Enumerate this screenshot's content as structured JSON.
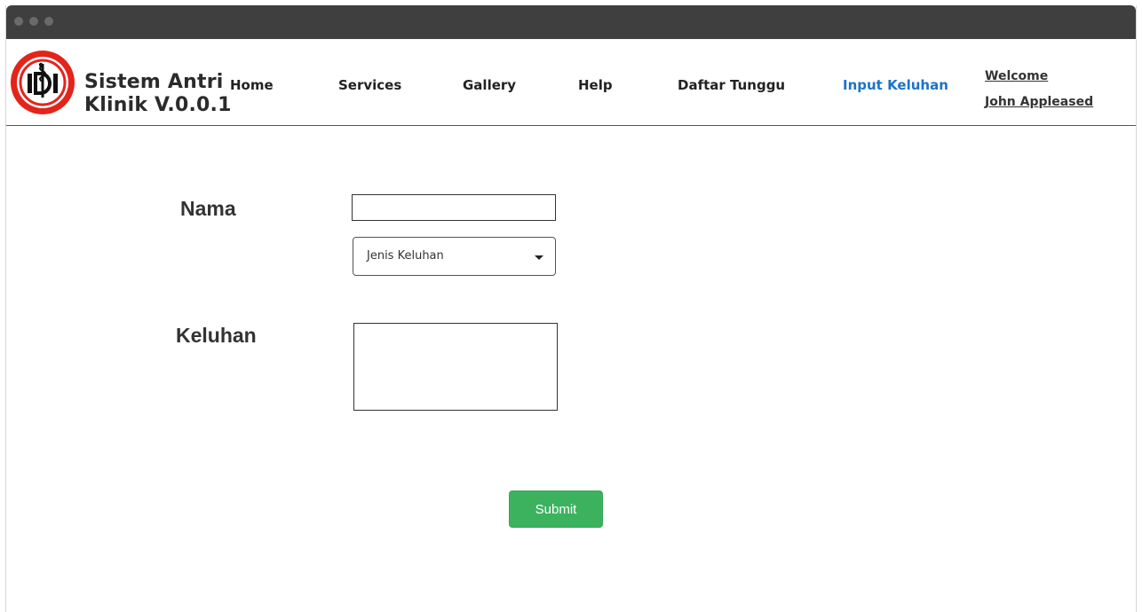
{
  "app": {
    "brand_line1": "Sistem Antri",
    "brand_line2": "Klinik V.0.0.1",
    "logo_icon": "idi-medical-logo-icon"
  },
  "nav": {
    "items": [
      {
        "label": "Home",
        "active": false
      },
      {
        "label": "Services",
        "active": false
      },
      {
        "label": "Gallery",
        "active": false
      },
      {
        "label": "Help",
        "active": false
      },
      {
        "label": "Daftar Tunggu",
        "active": false
      },
      {
        "label": "Input Keluhan",
        "active": true
      }
    ],
    "active_color": "#1a73c7"
  },
  "user": {
    "welcome_label": "Welcome",
    "name": "John Appleased"
  },
  "form": {
    "nama_label": "Nama",
    "nama_value": "",
    "jenis_keluhan_selected": "Jenis Keluhan",
    "keluhan_label": "Keluhan",
    "keluhan_value": "",
    "submit_label": "Submit"
  },
  "colors": {
    "submit_bg": "#3cb25e",
    "titlebar_bg": "#3f3f3f",
    "logo_red": "#e3241b"
  }
}
